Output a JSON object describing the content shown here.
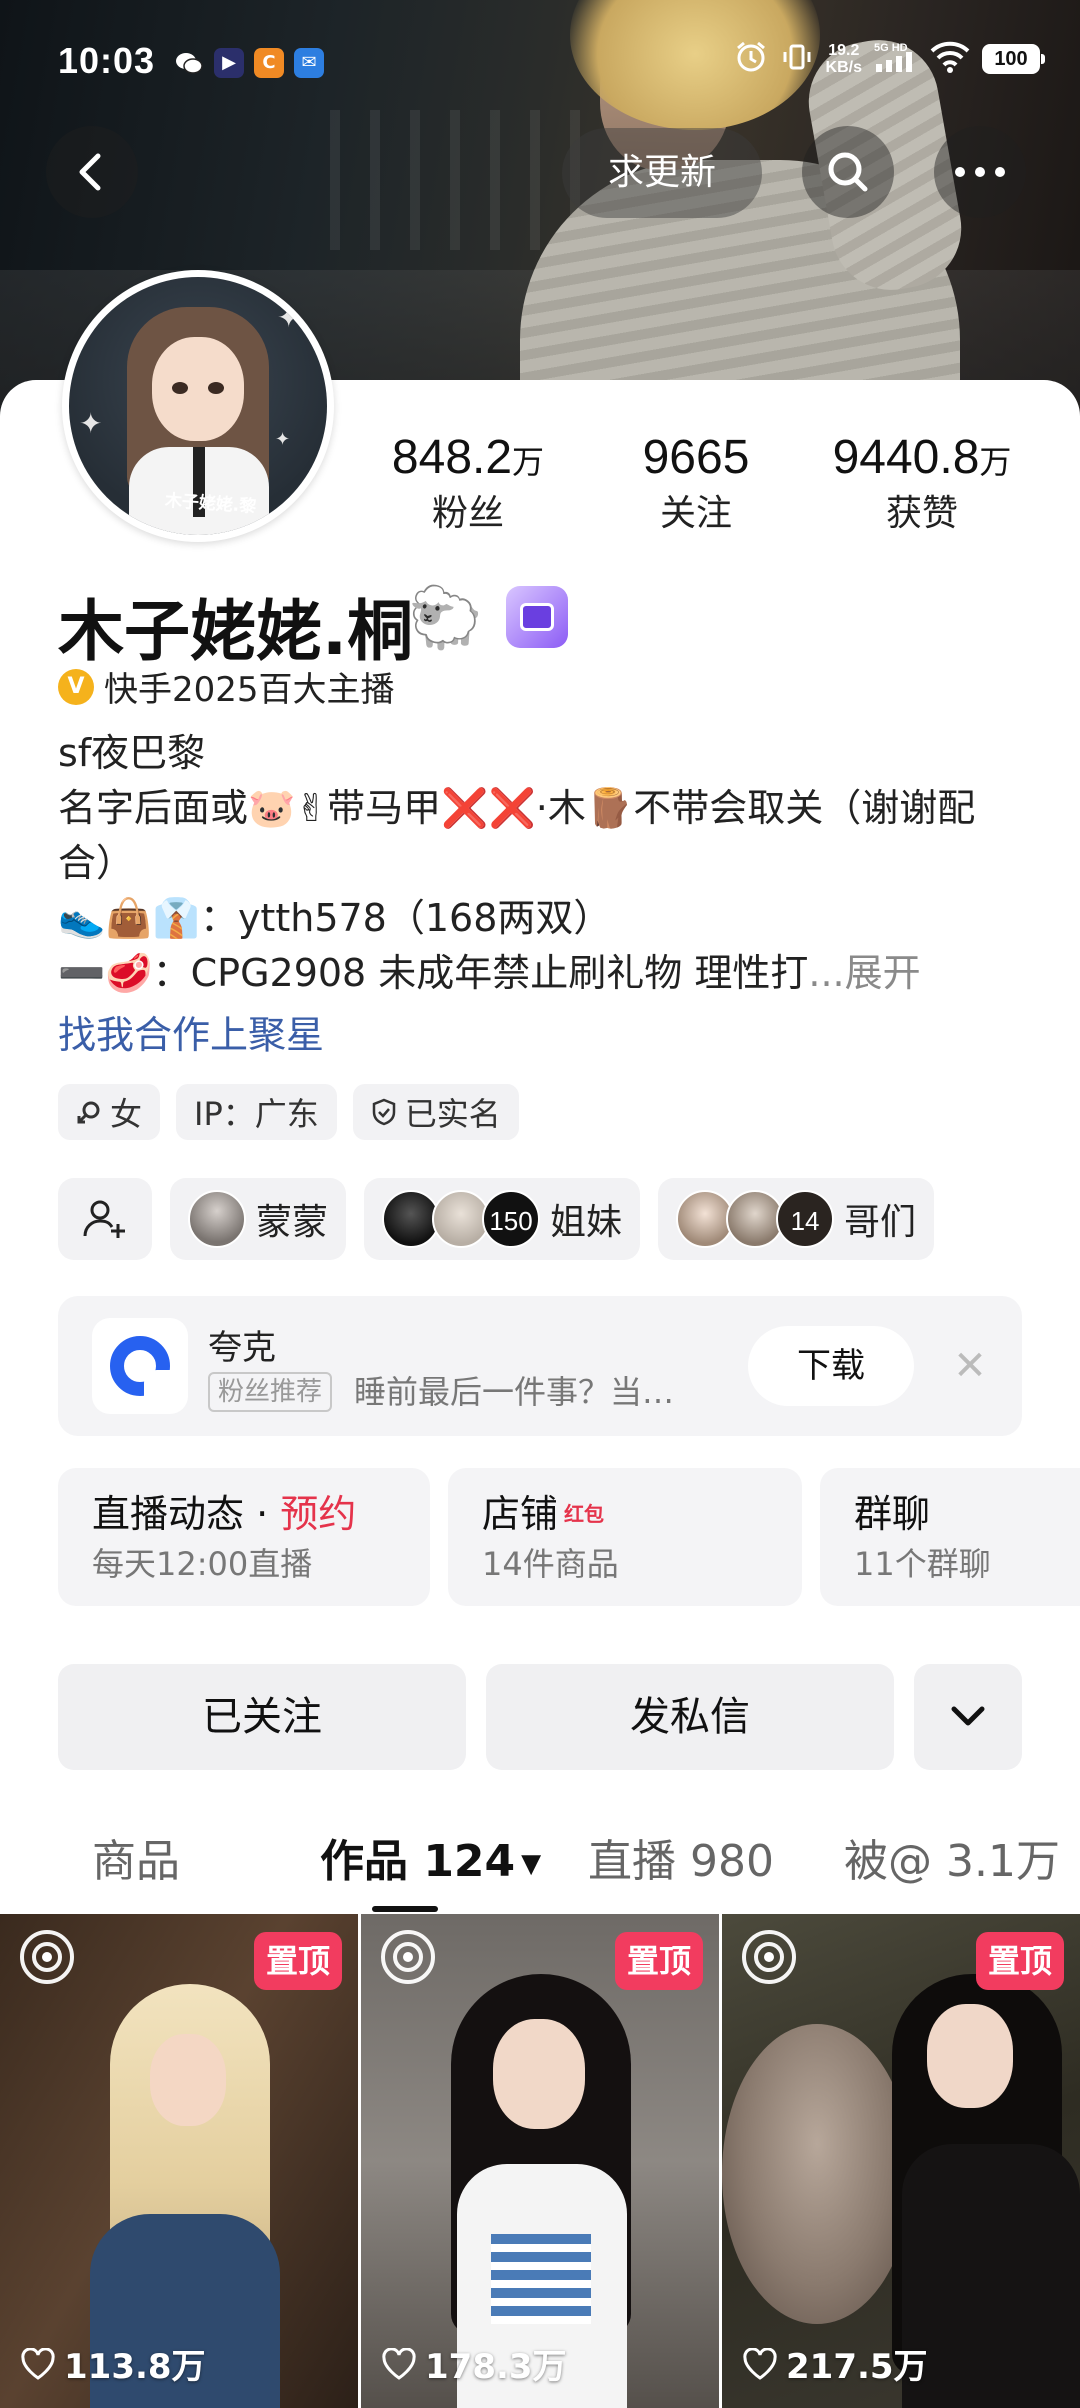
{
  "status_bar": {
    "time": "10:03",
    "speed_top": "19.2",
    "speed_unit": "KB/s",
    "network": "5G HD",
    "battery": "100"
  },
  "nav": {
    "update_label": "求更新"
  },
  "profile": {
    "name": "木子姥姥.桐",
    "avatar_text": "木子姥姥.黎",
    "verified_badge": "V",
    "verified_text": "快手2025百大主播",
    "stats": [
      {
        "value": "848.2",
        "unit": "万",
        "label": "粉丝"
      },
      {
        "value": "9665",
        "unit": "",
        "label": "关注"
      },
      {
        "value": "9440.8",
        "unit": "万",
        "label": "获赞"
      }
    ],
    "bio": {
      "line1": "sf夜巴黎",
      "line2_a": "名字后面或🐷✌带马甲",
      "line2_x": "❌❌",
      "line2_b": "·木🪵不带会取关（谢谢配合）",
      "line3": "👟👜👔：ytth578（168两双）",
      "line4": "➖🥩：CPG2908 未成年禁止刷礼物 理性打",
      "line4_more": "...展开"
    },
    "coop_link": "找我合作上聚星",
    "tags": [
      {
        "icon": "♀",
        "label": "女"
      },
      {
        "icon": "",
        "label": "IP：广东"
      },
      {
        "icon": "◇",
        "label": "已实名"
      }
    ]
  },
  "groups": [
    {
      "label": "蒙蒙"
    },
    {
      "label": "姐妹",
      "count": "150"
    },
    {
      "label": "哥们",
      "count": "14"
    }
  ],
  "ad": {
    "title": "夸克",
    "tag": "粉丝推荐",
    "desc": "睡前最后一件事？当…",
    "download": "下载",
    "close": "✕"
  },
  "features": {
    "live": {
      "title": "直播动态",
      "dot": "·",
      "highlight": "预约",
      "sub": "每天12:00直播"
    },
    "shop": {
      "title": "店铺",
      "badge": "红包",
      "sub": "14件商品"
    },
    "chat": {
      "title": "群聊",
      "sub": "11个群聊"
    }
  },
  "actions": {
    "follow": "已关注",
    "message": "发私信"
  },
  "tabs": [
    {
      "label": "商品"
    },
    {
      "label": "作品 124",
      "active": true
    },
    {
      "label": "直播 980"
    },
    {
      "label": "被@ 3.1万"
    }
  ],
  "videos": [
    {
      "pin": "置顶",
      "likes": "113.8万"
    },
    {
      "pin": "置顶",
      "likes": "178.3万"
    },
    {
      "pin": "置顶",
      "likes": "217.5万"
    }
  ]
}
